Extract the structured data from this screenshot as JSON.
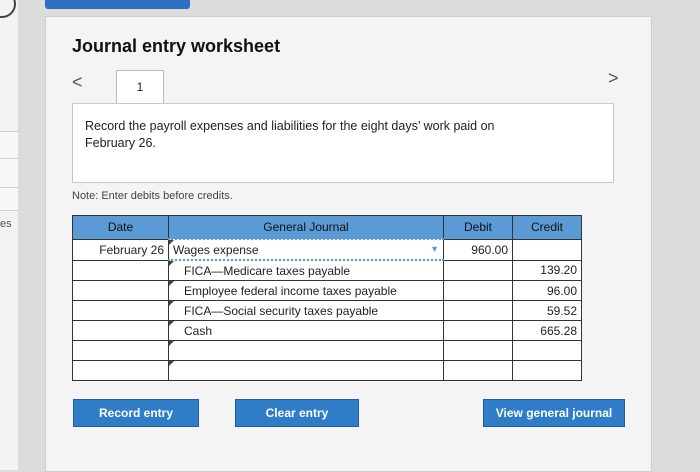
{
  "side": {
    "label": "es"
  },
  "page": {
    "title": "Journal entry worksheet"
  },
  "nav": {
    "prev": "<",
    "next": ">",
    "tab_label": "1"
  },
  "instructions": "Record the payroll expenses and liabilities for the eight days’ work paid on February 26.",
  "note": "Note: Enter debits before credits.",
  "table": {
    "headers": {
      "date": "Date",
      "account": "General Journal",
      "debit": "Debit",
      "credit": "Credit"
    },
    "rows": [
      {
        "date": "February 26",
        "account": "Wages expense",
        "debit": "960.00",
        "credit": ""
      },
      {
        "date": "",
        "account": "FICA—Medicare taxes payable",
        "debit": "",
        "credit": "139.20"
      },
      {
        "date": "",
        "account": "Employee federal income taxes payable",
        "debit": "",
        "credit": "96.00"
      },
      {
        "date": "",
        "account": "FICA—Social security taxes payable",
        "debit": "",
        "credit": "59.52"
      },
      {
        "date": "",
        "account": "Cash",
        "debit": "",
        "credit": "665.28"
      },
      {
        "date": "",
        "account": "",
        "debit": "",
        "credit": ""
      },
      {
        "date": "",
        "account": "",
        "debit": "",
        "credit": ""
      }
    ]
  },
  "buttons": {
    "record": "Record entry",
    "clear": "Clear entry",
    "view": "View general journal"
  },
  "colors": {
    "header_bg": "#5b9bd5",
    "button_bg": "#2f7dc9",
    "accent_bar": "#2f6fbf"
  },
  "icons": {
    "dropdown": "chevron-down-icon",
    "prev": "chevron-left-icon",
    "next": "chevron-right-icon"
  }
}
